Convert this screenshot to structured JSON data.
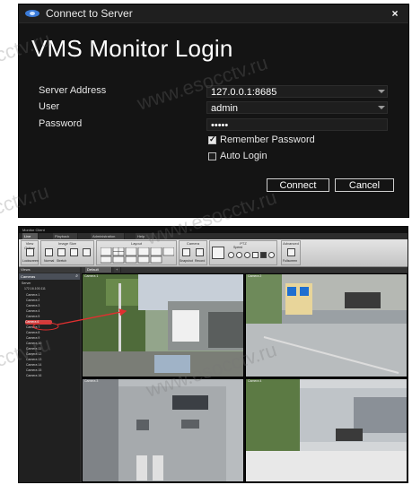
{
  "login": {
    "window_title": "Connect to Server",
    "close_glyph": "×",
    "heading": "VMS Monitor Login",
    "server_address_label": "Server Address",
    "server_address_value": "127.0.0.1:8685",
    "user_label": "User",
    "user_value": "admin",
    "password_label": "Password",
    "password_value": "•••••",
    "remember_password_label": "Remember Password",
    "remember_password_checked": true,
    "auto_login_label": "Auto Login",
    "auto_login_checked": false,
    "connect_label": "Connect",
    "cancel_label": "Cancel"
  },
  "client": {
    "window_title": "Monitor Client",
    "tabs": [
      "Live",
      "Playback",
      "Administration",
      "Help"
    ],
    "ribbon_groups": {
      "view_option": "View Option",
      "image_size": "Image Size",
      "layout": "Layout",
      "camera": "Camera",
      "ptz": "PTZ",
      "advanced": "Advanced"
    },
    "ribbon_buttons": {
      "lockscreen": "Lockscreen",
      "normal": "Normal",
      "stretch": "Stretch",
      "snapshot": "Snapshot",
      "record": "Record",
      "speed": "Speed",
      "fullscreen": "Fullscreen"
    },
    "views_label": "Views",
    "cameras_label": "Cameras",
    "view_tab": "Default",
    "tree": [
      "Server",
      "172.16.100.111",
      "Camera 1",
      "Camera 2",
      "Camera 3",
      "Camera 4",
      "Camera 5",
      "Camera 6",
      "Camera 7",
      "Camera 8",
      "Camera 9",
      "Camera 10",
      "Camera 11",
      "Camera 12",
      "Camera 13",
      "Camera 14",
      "Camera 15",
      "Camera 16"
    ],
    "selected_tree_index": 7,
    "tiles": [
      {
        "label": "Camera 1"
      },
      {
        "label": "Camera 2"
      },
      {
        "label": "Camera 3"
      },
      {
        "label": "Camera 4"
      }
    ]
  },
  "watermarks": [
    "cctv.ru",
    "www.esocctv.ru",
    "www.esocctv.ru",
    "cctv.ru",
    "www.esocctv.ru",
    "cctv.ru",
    "www.esocctv.ru"
  ],
  "colors": {
    "dialog_bg": "#141414",
    "selection": "#d04040",
    "arrow": "#e03030"
  }
}
